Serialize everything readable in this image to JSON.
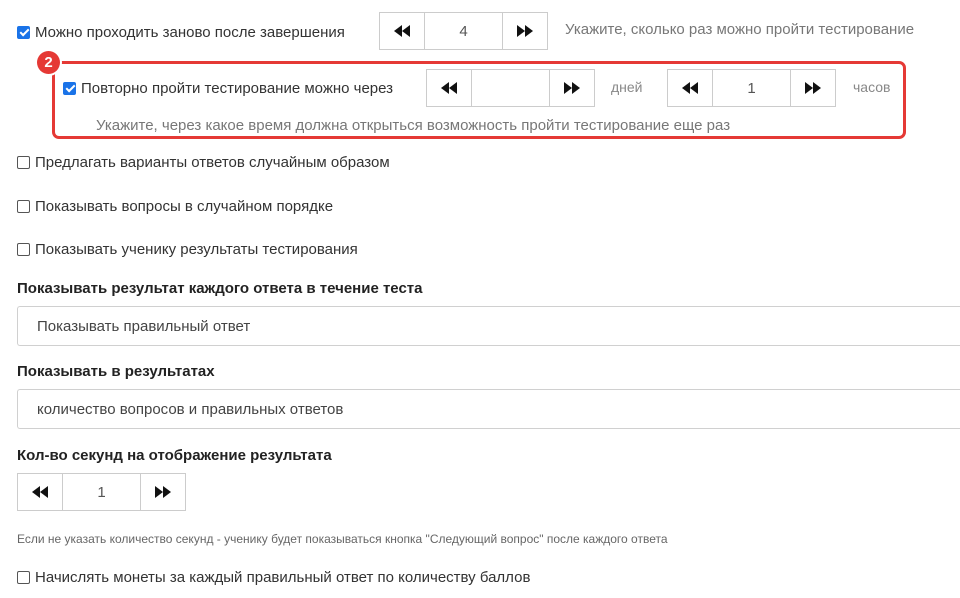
{
  "retake": {
    "checkbox_label": "Можно проходить заново после завершения",
    "checked": true,
    "stepper_value": "4",
    "hint": "Укажите, сколько раз можно пройти тестирование"
  },
  "repeat_after": {
    "badge": "2",
    "checkbox_label": "Повторно пройти тестирование можно через",
    "checked": true,
    "days_value": "",
    "days_unit": "дней",
    "hours_value": "1",
    "hours_unit": "часов",
    "hint": "Укажите, через какое время должна открыться возможность пройти тестирование еще раз",
    "highlight_color": "#e53935"
  },
  "options": [
    {
      "label": "Предлагать варианты ответов случайным образом",
      "checked": false
    },
    {
      "label": "Показывать вопросы в случайном порядке",
      "checked": false
    },
    {
      "label": "Показывать ученику результаты тестирования",
      "checked": false
    }
  ],
  "show_each_answer": {
    "heading": "Показывать результат каждого ответа в течение теста",
    "selected": "Показывать правильный ответ"
  },
  "show_in_results": {
    "heading": "Показывать в результатах",
    "selected": "количество вопросов и правильных ответов"
  },
  "seconds": {
    "heading": "Кол-во секунд на отображение результата",
    "value": "1",
    "note": "Если не указать количество секунд - ученику будет показываться кнопка \"Следующий вопрос\" после каждого ответа"
  },
  "coins": {
    "label": "Начислять монеты за каждый правильный ответ по количеству баллов",
    "checked": false
  },
  "icons": {
    "decrement": "double-left-arrow-icon",
    "increment": "double-right-arrow-icon"
  },
  "accent_color": "#1a73e8"
}
